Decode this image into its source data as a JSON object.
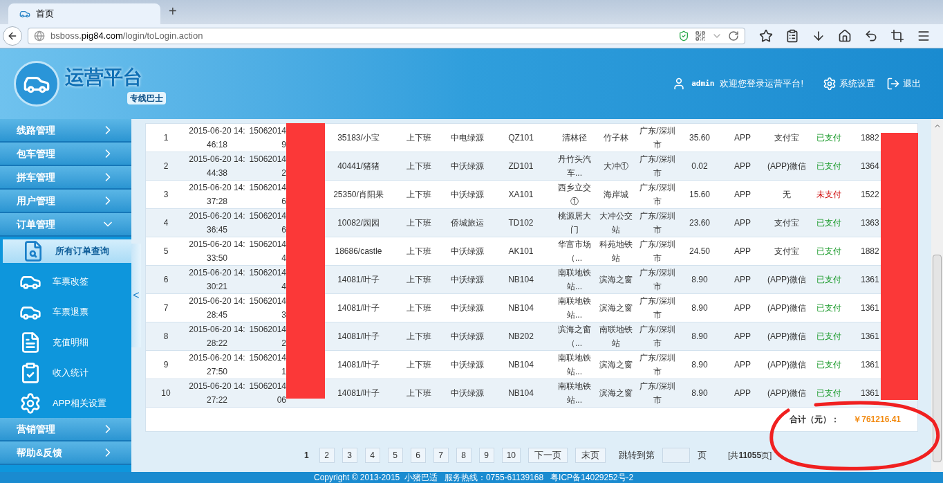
{
  "browser": {
    "tab": {
      "title": "首页",
      "selected": true
    },
    "new_tab": "+",
    "url": {
      "host_prefix": "bsboss.",
      "host_domain": "pig84.com",
      "path": "/login/toLogin.action"
    }
  },
  "header": {
    "title": "运营平台",
    "subtitle": "专线巴士",
    "user": "admin",
    "welcome": "欢迎您登录运营平台!",
    "settings": "系统设置",
    "logout": "退出"
  },
  "sidebar": {
    "groups": [
      {
        "label": "线路管理",
        "expanded": false
      },
      {
        "label": "包车管理",
        "expanded": false
      },
      {
        "label": "拼车管理",
        "expanded": false
      },
      {
        "label": "用户管理",
        "expanded": false
      },
      {
        "label": "订单管理",
        "expanded": true,
        "children": [
          {
            "label": "所有订单查询",
            "kind": "search",
            "selected": true
          },
          {
            "label": "车票改签",
            "kind": "car",
            "selected": false
          },
          {
            "label": "车票退票",
            "kind": "car",
            "selected": false
          },
          {
            "label": "充值明细",
            "kind": "document",
            "selected": false
          },
          {
            "label": "收入统计",
            "kind": "clipboard",
            "selected": false
          },
          {
            "label": "APP相关设置",
            "kind": "gear",
            "selected": false
          }
        ]
      },
      {
        "label": "营销管理",
        "expanded": false
      },
      {
        "label": "帮助&反馈",
        "expanded": false
      }
    ],
    "collapse": "<"
  },
  "table": {
    "rows": [
      {
        "index": "1",
        "time": "2015-06-20 14:46:18",
        "order_no": "15062014",
        "order_tail": "9",
        "user": "35183/小宝",
        "type": "上下班",
        "company": "中电绿源",
        "route": "QZ101",
        "start": "清林径",
        "end": "竹子林",
        "city": "广东/深圳市",
        "price": "35.60",
        "channel": "APP",
        "payment": "支付宝",
        "status": "已支付",
        "paid": true,
        "phone": "1882"
      },
      {
        "index": "2",
        "time": "2015-06-20 14:44:38",
        "order_no": "15062014",
        "order_tail": "2",
        "user": "40441/猪猪",
        "type": "上下班",
        "company": "中沃绿源",
        "route": "ZD101",
        "start": "丹竹头汽车...",
        "end": "大冲①",
        "city": "广东/深圳市",
        "price": "0.02",
        "channel": "APP",
        "payment": "(APP)微信",
        "status": "已支付",
        "paid": true,
        "phone": "1364"
      },
      {
        "index": "3",
        "time": "2015-06-20 14:37:28",
        "order_no": "15062014",
        "order_tail": "6",
        "user": "25350/肖阳果",
        "type": "上下班",
        "company": "中沃绿源",
        "route": "XA101",
        "start": "西乡立交①",
        "end": "海岸城",
        "city": "广东/深圳市",
        "price": "15.60",
        "channel": "APP",
        "payment": "无",
        "status": "未支付",
        "paid": false,
        "phone": "1522"
      },
      {
        "index": "4",
        "time": "2015-06-20 14:36:45",
        "order_no": "15062014",
        "order_tail": "6",
        "user": "10082/园园",
        "type": "上下班",
        "company": "侨城旅运",
        "route": "TD102",
        "start": "桃源居大门",
        "end": "大冲公交站",
        "city": "广东/深圳市",
        "price": "23.60",
        "channel": "APP",
        "payment": "支付宝",
        "status": "已支付",
        "paid": true,
        "phone": "1363"
      },
      {
        "index": "5",
        "time": "2015-06-20 14:33:50",
        "order_no": "15062014",
        "order_tail": "4",
        "user": "18686/castle",
        "type": "上下班",
        "company": "中沃绿源",
        "route": "AK101",
        "start": "华富市场（...",
        "end": "科苑地铁站",
        "city": "广东/深圳市",
        "price": "24.50",
        "channel": "APP",
        "payment": "支付宝",
        "status": "已支付",
        "paid": true,
        "phone": "1882"
      },
      {
        "index": "6",
        "time": "2015-06-20 14:30:21",
        "order_no": "15062014",
        "order_tail": "4",
        "user": "14081/叶子",
        "type": "上下班",
        "company": "中沃绿源",
        "route": "NB104",
        "start": "南联地铁站...",
        "end": "滨海之窗",
        "city": "广东/深圳市",
        "price": "8.90",
        "channel": "APP",
        "payment": "(APP)微信",
        "status": "已支付",
        "paid": true,
        "phone": "1361"
      },
      {
        "index": "7",
        "time": "2015-06-20 14:28:45",
        "order_no": "15062014",
        "order_tail": "3",
        "user": "14081/叶子",
        "type": "上下班",
        "company": "中沃绿源",
        "route": "NB104",
        "start": "南联地铁站...",
        "end": "滨海之窗",
        "city": "广东/深圳市",
        "price": "8.90",
        "channel": "APP",
        "payment": "(APP)微信",
        "status": "已支付",
        "paid": true,
        "phone": "1361"
      },
      {
        "index": "8",
        "time": "2015-06-20 14:28:22",
        "order_no": "15062014",
        "order_tail": "2",
        "user": "14081/叶子",
        "type": "上下班",
        "company": "中沃绿源",
        "route": "NB202",
        "start": "滨海之窗（...",
        "end": "南联地铁站",
        "city": "广东/深圳市",
        "price": "8.90",
        "channel": "APP",
        "payment": "(APP)微信",
        "status": "已支付",
        "paid": true,
        "phone": "1361"
      },
      {
        "index": "9",
        "time": "2015-06-20 14:27:50",
        "order_no": "15062014",
        "order_tail": "1",
        "user": "14081/叶子",
        "type": "上下班",
        "company": "中沃绿源",
        "route": "NB104",
        "start": "南联地铁站...",
        "end": "滨海之窗",
        "city": "广东/深圳市",
        "price": "8.90",
        "channel": "APP",
        "payment": "(APP)微信",
        "status": "已支付",
        "paid": true,
        "phone": "1361"
      },
      {
        "index": "10",
        "time": "2015-06-20 14:27:22",
        "order_no": "15062014",
        "order_tail": "06",
        "user": "14081/叶子",
        "type": "上下班",
        "company": "中沃绿源",
        "route": "NB104",
        "start": "南联地铁站...",
        "end": "滨海之窗",
        "city": "广东/深圳市",
        "price": "8.90",
        "channel": "APP",
        "payment": "(APP)微信",
        "status": "已支付",
        "paid": true,
        "phone": "1361"
      }
    ],
    "total_label": "合计（元）：",
    "total_value": "￥761216.41"
  },
  "pagination": {
    "pages": [
      {
        "label": "1",
        "selected": true
      },
      {
        "label": "2",
        "selected": false
      },
      {
        "label": "3",
        "selected": false
      },
      {
        "label": "4",
        "selected": false
      },
      {
        "label": "5",
        "selected": false
      },
      {
        "label": "6",
        "selected": false
      },
      {
        "label": "7",
        "selected": false
      },
      {
        "label": "8",
        "selected": false
      },
      {
        "label": "9",
        "selected": false
      },
      {
        "label": "10",
        "selected": false
      }
    ],
    "next": "下一页",
    "last": "末页",
    "jump_label": "跳转到第",
    "jump_suffix": "页",
    "total": "[共**11055**页]"
  },
  "footer": "Copyright © 2013-2015  小猪巴适   服务热线：0755-61139168   粤ICP备14029252号-2"
}
